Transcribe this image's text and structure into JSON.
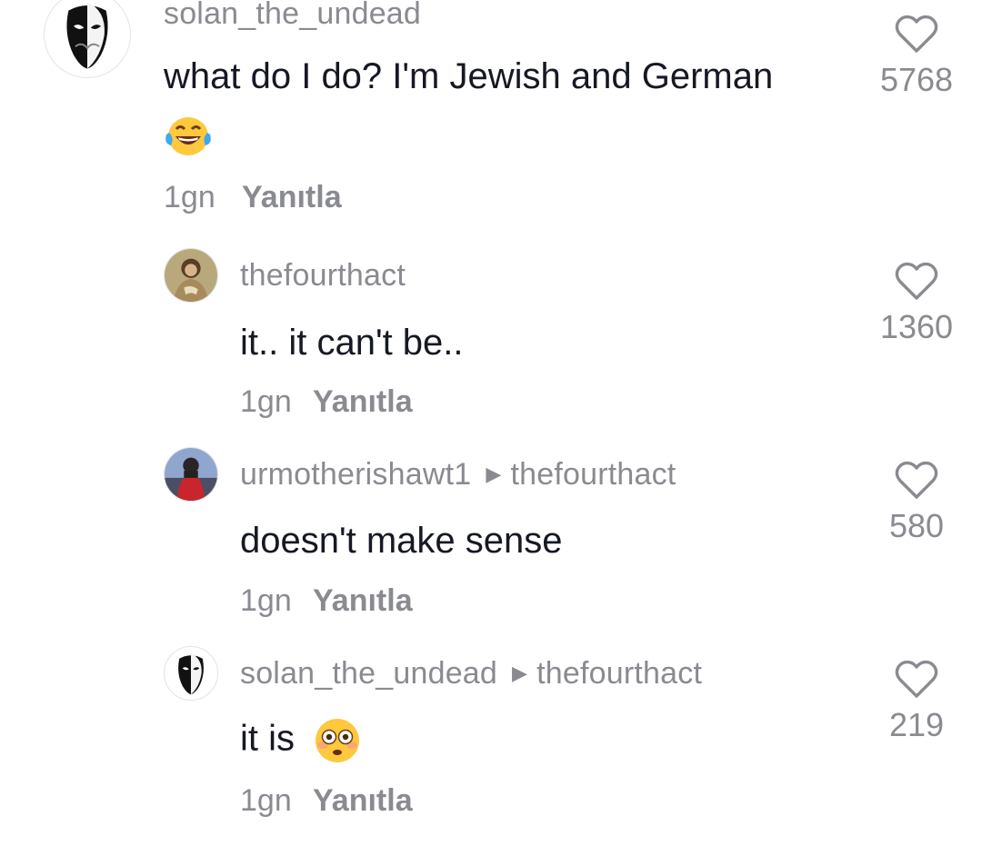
{
  "comments": [
    {
      "username": "solan_the_undead",
      "text_line1": "what do I do? I'm Jewish and German",
      "emoji": "joy-emoji",
      "time": "1gn",
      "reply_label": "Yanıtla",
      "likes": "5768"
    }
  ],
  "replies": [
    {
      "username": "thefourthact",
      "reply_to": "",
      "text": "it.. it can't be..",
      "time": "1gn",
      "reply_label": "Yanıtla",
      "likes": "1360"
    },
    {
      "username": "urmotherishawt1",
      "reply_to": "thefourthact",
      "text": "doesn't make sense",
      "time": "1gn",
      "reply_label": "Yanıtla",
      "likes": "580"
    },
    {
      "username": "solan_the_undead",
      "reply_to": "thefourthact",
      "text": "it is",
      "emoji": "flushed-emoji",
      "time": "1gn",
      "reply_label": "Yanıtla",
      "likes": "219"
    }
  ],
  "icons": {
    "heart": "heart-outline-icon",
    "reply_arrow": "caret-right-icon"
  },
  "colors": {
    "text_primary": "#161823",
    "text_secondary": "#8a8b91",
    "background": "#ffffff"
  }
}
